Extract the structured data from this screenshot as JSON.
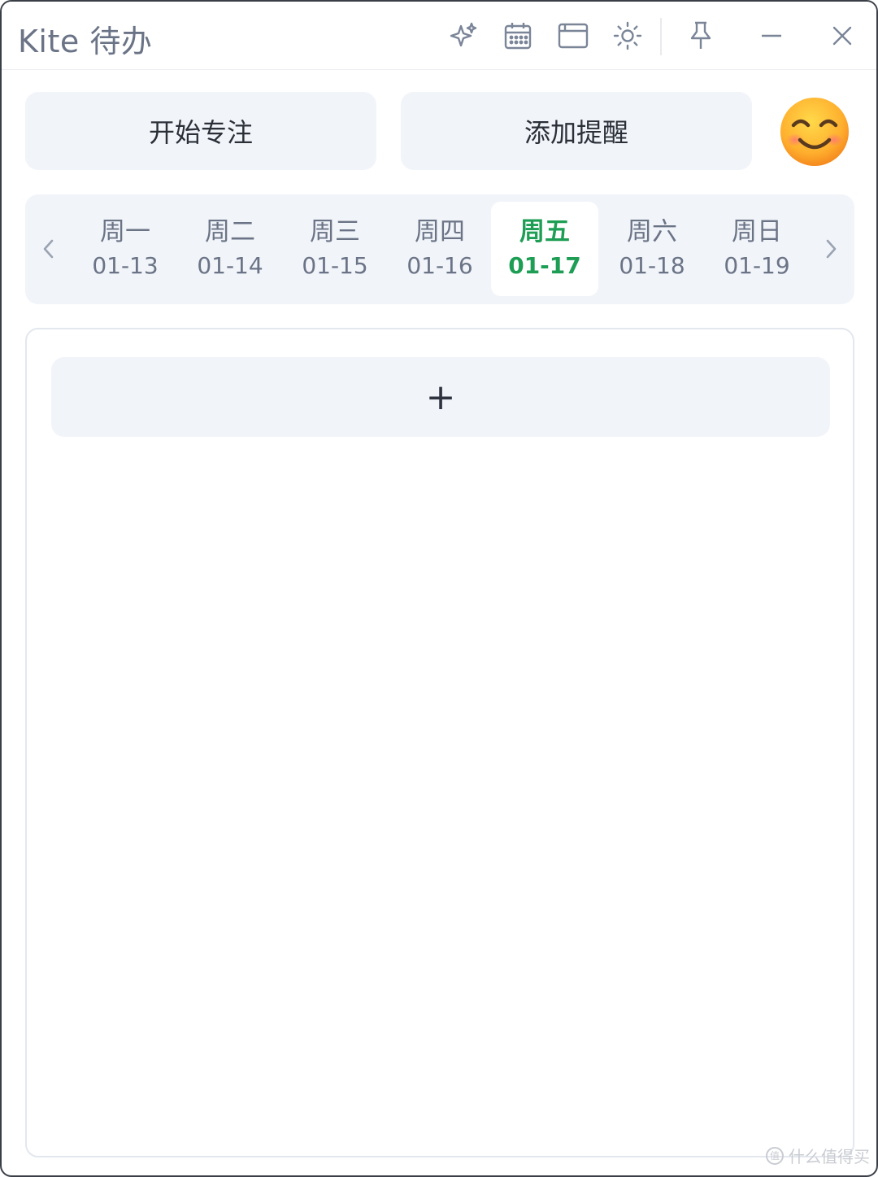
{
  "window": {
    "title": "Kite 待办"
  },
  "toolbar": {
    "icons": [
      "sparkle-icon",
      "calendar-icon",
      "window-icon",
      "sun-icon",
      "pin-icon",
      "minimize-icon",
      "close-icon"
    ]
  },
  "actions": {
    "focus_label": "开始专注",
    "reminder_label": "添加提醒"
  },
  "week": {
    "days": [
      {
        "weekday": "周一",
        "date": "01-13"
      },
      {
        "weekday": "周二",
        "date": "01-14"
      },
      {
        "weekday": "周三",
        "date": "01-15"
      },
      {
        "weekday": "周四",
        "date": "01-16"
      },
      {
        "weekday": "周五",
        "date": "01-17"
      },
      {
        "weekday": "周六",
        "date": "01-18"
      },
      {
        "weekday": "周日",
        "date": "01-19"
      }
    ],
    "selected_index": 4
  },
  "todo": {
    "add_label": "+"
  },
  "colors": {
    "accent": "#1e9e55",
    "muted_text": "#6b7486",
    "panel_bg": "#f1f4f9"
  },
  "watermark": {
    "text": "什么值得买",
    "badge": "值"
  }
}
